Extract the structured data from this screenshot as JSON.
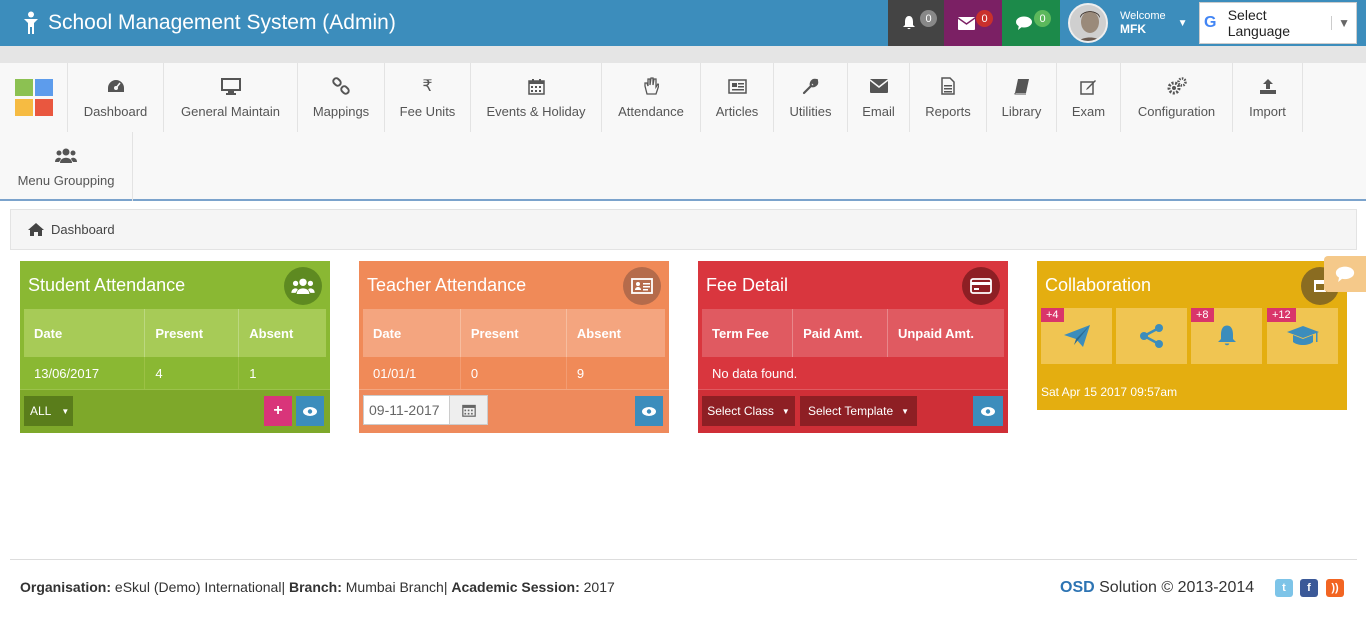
{
  "header": {
    "title": "School Management System (Admin)",
    "notifications": [
      {
        "icon": "bell-icon",
        "count": "0"
      },
      {
        "icon": "envelope-icon",
        "count": "0"
      },
      {
        "icon": "chat-icon",
        "count": "0"
      }
    ],
    "user": {
      "welcome": "Welcome",
      "name": "MFK"
    },
    "language": "Select Language"
  },
  "nav": [
    {
      "label": "Dashboard",
      "icon": "dashboard-icon"
    },
    {
      "label": "General Maintain",
      "icon": "monitor-icon"
    },
    {
      "label": "Mappings",
      "icon": "link-icon"
    },
    {
      "label": "Fee Units",
      "icon": "rupee-icon"
    },
    {
      "label": "Events & Holiday",
      "icon": "calendar-icon"
    },
    {
      "label": "Attendance",
      "icon": "hand-icon"
    },
    {
      "label": "Articles",
      "icon": "newspaper-icon"
    },
    {
      "label": "Utilities",
      "icon": "wrench-icon"
    },
    {
      "label": "Email",
      "icon": "envelope-icon"
    },
    {
      "label": "Reports",
      "icon": "file-icon"
    },
    {
      "label": "Library",
      "icon": "book-icon"
    },
    {
      "label": "Exam",
      "icon": "edit-icon"
    },
    {
      "label": "Configuration",
      "icon": "gears-icon"
    },
    {
      "label": "Import",
      "icon": "upload-icon"
    },
    {
      "label": "Menu Groupping",
      "icon": "users-icon"
    }
  ],
  "breadcrumb": {
    "label": "Dashboard"
  },
  "student_attendance": {
    "title": "Student Attendance",
    "headers": [
      "Date",
      "Present",
      "Absent"
    ],
    "row": [
      "13/06/2017",
      "4",
      "1"
    ],
    "filter": "ALL"
  },
  "teacher_attendance": {
    "title": "Teacher Attendance",
    "headers": [
      "Date",
      "Present",
      "Absent"
    ],
    "row": [
      "01/01/1",
      "0",
      "9"
    ],
    "date_value": "09-11-2017"
  },
  "fee_detail": {
    "title": "Fee Detail",
    "headers": [
      "Term Fee",
      "Paid Amt.",
      "Unpaid Amt."
    ],
    "empty": "No data found.",
    "select_class": "Select Class",
    "select_template": "Select Template"
  },
  "collaboration": {
    "title": "Collaboration",
    "tiles": [
      {
        "icon": "send-icon",
        "badge": "+4"
      },
      {
        "icon": "share-icon",
        "badge": ""
      },
      {
        "icon": "bell-icon",
        "badge": "+8"
      },
      {
        "icon": "graduation-cap-icon",
        "badge": "+12"
      }
    ],
    "timestamp": "Sat Apr 15 2017 09:57am"
  },
  "footer": {
    "org_label": "Organisation:",
    "org_value": "eSkul (Demo) International",
    "branch_label": "Branch:",
    "branch_value": "Mumbai Branch",
    "session_label": "Academic Session:",
    "session_value": "2017",
    "brand": "OSD",
    "copyright": "Solution © 2013-2014"
  },
  "colors": {
    "header": "#3c8dbc",
    "student": "#8ab833",
    "teacher": "#f08a58",
    "fee": "#d9363e",
    "collab": "#e4ae10"
  }
}
